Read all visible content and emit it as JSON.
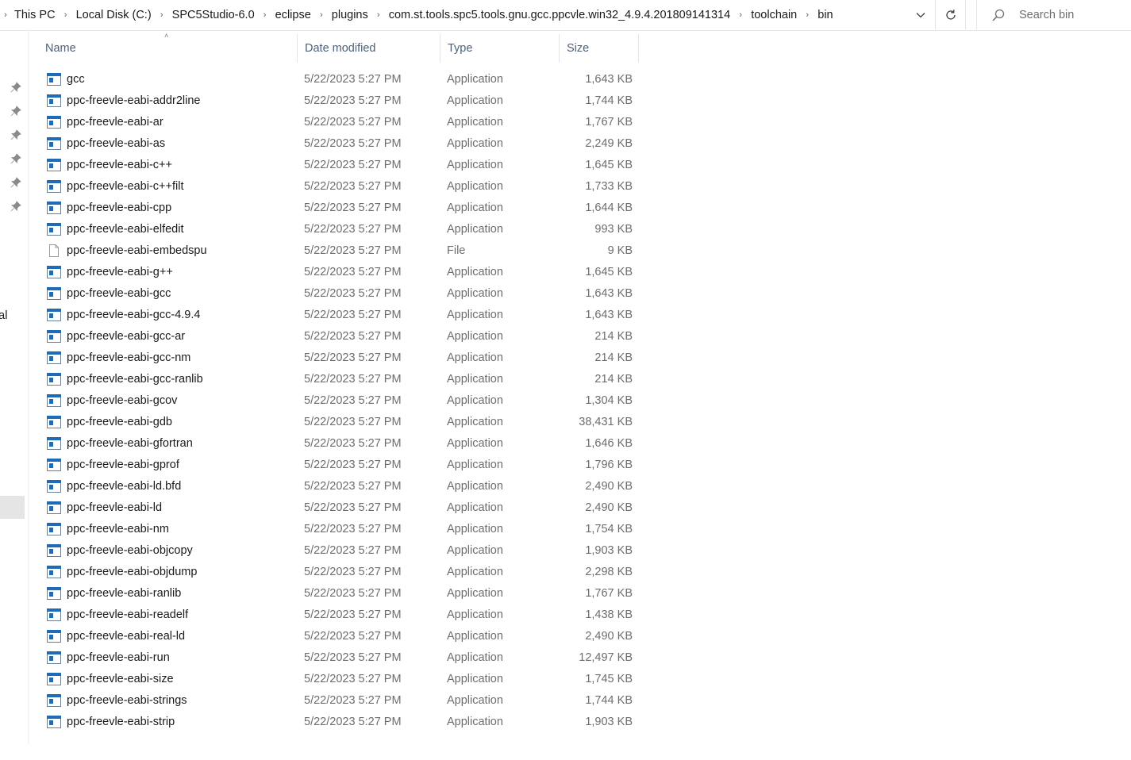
{
  "address": {
    "crumbs": [
      "This PC",
      "Local Disk (C:)",
      "SPC5Studio-6.0",
      "eclipse",
      "plugins",
      "com.st.tools.spc5.tools.gnu.gcc.ppcvle.win32_4.9.4.201809141314",
      "toolchain",
      "bin"
    ],
    "search_placeholder": "Search bin"
  },
  "nav": {
    "partial_label": "onal"
  },
  "columns": {
    "name": "Name",
    "date": "Date modified",
    "type": "Type",
    "size": "Size"
  },
  "files": [
    {
      "name": "gcc",
      "date": "5/22/2023 5:27 PM",
      "type": "Application",
      "size": "1,643 KB",
      "icon": "application-icon"
    },
    {
      "name": "ppc-freevle-eabi-addr2line",
      "date": "5/22/2023 5:27 PM",
      "type": "Application",
      "size": "1,744 KB",
      "icon": "application-icon"
    },
    {
      "name": "ppc-freevle-eabi-ar",
      "date": "5/22/2023 5:27 PM",
      "type": "Application",
      "size": "1,767 KB",
      "icon": "application-icon"
    },
    {
      "name": "ppc-freevle-eabi-as",
      "date": "5/22/2023 5:27 PM",
      "type": "Application",
      "size": "2,249 KB",
      "icon": "application-icon"
    },
    {
      "name": "ppc-freevle-eabi-c++",
      "date": "5/22/2023 5:27 PM",
      "type": "Application",
      "size": "1,645 KB",
      "icon": "application-icon"
    },
    {
      "name": "ppc-freevle-eabi-c++filt",
      "date": "5/22/2023 5:27 PM",
      "type": "Application",
      "size": "1,733 KB",
      "icon": "application-icon"
    },
    {
      "name": "ppc-freevle-eabi-cpp",
      "date": "5/22/2023 5:27 PM",
      "type": "Application",
      "size": "1,644 KB",
      "icon": "application-icon"
    },
    {
      "name": "ppc-freevle-eabi-elfedit",
      "date": "5/22/2023 5:27 PM",
      "type": "Application",
      "size": "993 KB",
      "icon": "application-icon"
    },
    {
      "name": "ppc-freevle-eabi-embedspu",
      "date": "5/22/2023 5:27 PM",
      "type": "File",
      "size": "9 KB",
      "icon": "file-icon"
    },
    {
      "name": "ppc-freevle-eabi-g++",
      "date": "5/22/2023 5:27 PM",
      "type": "Application",
      "size": "1,645 KB",
      "icon": "application-icon"
    },
    {
      "name": "ppc-freevle-eabi-gcc",
      "date": "5/22/2023 5:27 PM",
      "type": "Application",
      "size": "1,643 KB",
      "icon": "application-icon"
    },
    {
      "name": "ppc-freevle-eabi-gcc-4.9.4",
      "date": "5/22/2023 5:27 PM",
      "type": "Application",
      "size": "1,643 KB",
      "icon": "application-icon"
    },
    {
      "name": "ppc-freevle-eabi-gcc-ar",
      "date": "5/22/2023 5:27 PM",
      "type": "Application",
      "size": "214 KB",
      "icon": "application-icon"
    },
    {
      "name": "ppc-freevle-eabi-gcc-nm",
      "date": "5/22/2023 5:27 PM",
      "type": "Application",
      "size": "214 KB",
      "icon": "application-icon"
    },
    {
      "name": "ppc-freevle-eabi-gcc-ranlib",
      "date": "5/22/2023 5:27 PM",
      "type": "Application",
      "size": "214 KB",
      "icon": "application-icon"
    },
    {
      "name": "ppc-freevle-eabi-gcov",
      "date": "5/22/2023 5:27 PM",
      "type": "Application",
      "size": "1,304 KB",
      "icon": "application-icon"
    },
    {
      "name": "ppc-freevle-eabi-gdb",
      "date": "5/22/2023 5:27 PM",
      "type": "Application",
      "size": "38,431 KB",
      "icon": "application-icon"
    },
    {
      "name": "ppc-freevle-eabi-gfortran",
      "date": "5/22/2023 5:27 PM",
      "type": "Application",
      "size": "1,646 KB",
      "icon": "application-icon"
    },
    {
      "name": "ppc-freevle-eabi-gprof",
      "date": "5/22/2023 5:27 PM",
      "type": "Application",
      "size": "1,796 KB",
      "icon": "application-icon"
    },
    {
      "name": "ppc-freevle-eabi-ld.bfd",
      "date": "5/22/2023 5:27 PM",
      "type": "Application",
      "size": "2,490 KB",
      "icon": "application-icon"
    },
    {
      "name": "ppc-freevle-eabi-ld",
      "date": "5/22/2023 5:27 PM",
      "type": "Application",
      "size": "2,490 KB",
      "icon": "application-icon"
    },
    {
      "name": "ppc-freevle-eabi-nm",
      "date": "5/22/2023 5:27 PM",
      "type": "Application",
      "size": "1,754 KB",
      "icon": "application-icon"
    },
    {
      "name": "ppc-freevle-eabi-objcopy",
      "date": "5/22/2023 5:27 PM",
      "type": "Application",
      "size": "1,903 KB",
      "icon": "application-icon"
    },
    {
      "name": "ppc-freevle-eabi-objdump",
      "date": "5/22/2023 5:27 PM",
      "type": "Application",
      "size": "2,298 KB",
      "icon": "application-icon"
    },
    {
      "name": "ppc-freevle-eabi-ranlib",
      "date": "5/22/2023 5:27 PM",
      "type": "Application",
      "size": "1,767 KB",
      "icon": "application-icon"
    },
    {
      "name": "ppc-freevle-eabi-readelf",
      "date": "5/22/2023 5:27 PM",
      "type": "Application",
      "size": "1,438 KB",
      "icon": "application-icon"
    },
    {
      "name": "ppc-freevle-eabi-real-ld",
      "date": "5/22/2023 5:27 PM",
      "type": "Application",
      "size": "2,490 KB",
      "icon": "application-icon"
    },
    {
      "name": "ppc-freevle-eabi-run",
      "date": "5/22/2023 5:27 PM",
      "type": "Application",
      "size": "12,497 KB",
      "icon": "application-icon"
    },
    {
      "name": "ppc-freevle-eabi-size",
      "date": "5/22/2023 5:27 PM",
      "type": "Application",
      "size": "1,745 KB",
      "icon": "application-icon"
    },
    {
      "name": "ppc-freevle-eabi-strings",
      "date": "5/22/2023 5:27 PM",
      "type": "Application",
      "size": "1,744 KB",
      "icon": "application-icon"
    },
    {
      "name": "ppc-freevle-eabi-strip",
      "date": "5/22/2023 5:27 PM",
      "type": "Application",
      "size": "1,903 KB",
      "icon": "application-icon"
    }
  ],
  "colors": {
    "header_text": "#4c607a",
    "meta_text": "#6d6d6d",
    "icon_accent": "#1e6bb8",
    "selection": "#e5e5e5"
  }
}
